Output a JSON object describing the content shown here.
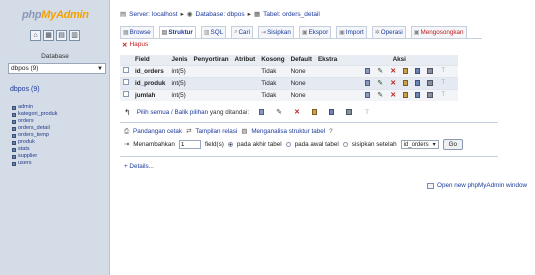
{
  "sidebar": {
    "logo_part1": "php",
    "logo_part2": "MyAdmin",
    "icons": [
      "home-icon",
      "sql-query-icon",
      "docs-icon",
      "help-icon"
    ],
    "icon_glyphs": [
      "⌂",
      "▦",
      "▤",
      "▥"
    ],
    "database_label": "Database",
    "database_selected": "dbpos (9)",
    "db_title": "dbpos (9)",
    "tables": [
      "admin",
      "kategori_produk",
      "orders",
      "orders_detail",
      "orders_temp",
      "produk",
      "stats",
      "supplier",
      "users"
    ]
  },
  "breadcrumb": {
    "server": "Server: localhost",
    "database": "Database: dbpos",
    "table": "Tabel: orders_detail"
  },
  "tabs": [
    {
      "label": "Browse",
      "active": false,
      "danger": false
    },
    {
      "label": "Struktur",
      "active": true,
      "danger": false
    },
    {
      "label": "SQL",
      "active": false,
      "danger": false
    },
    {
      "label": "Cari",
      "active": false,
      "danger": false
    },
    {
      "label": "Sisipkan",
      "active": false,
      "danger": false
    },
    {
      "label": "Ekspor",
      "active": false,
      "danger": false
    },
    {
      "label": "Import",
      "active": false,
      "danger": false
    },
    {
      "label": "Operasi",
      "active": false,
      "danger": false
    },
    {
      "label": "Mengosongkan",
      "active": false,
      "danger": true
    }
  ],
  "hapus_label": "Hapus",
  "structure_table": {
    "headers": [
      "Field",
      "Jenis",
      "Penyortiran",
      "Atribut",
      "Kosong",
      "Default",
      "Ekstra",
      "Aksi"
    ],
    "rows": [
      {
        "field": "id_orders",
        "jenis": "int(5)",
        "penyortiran": "",
        "atribut": "",
        "kosong": "Tidak",
        "default": "None",
        "ekstra": ""
      },
      {
        "field": "id_produk",
        "jenis": "int(5)",
        "penyortiran": "",
        "atribut": "",
        "kosong": "Tidak",
        "default": "None",
        "ekstra": ""
      },
      {
        "field": "jumlah",
        "jenis": "int(5)",
        "penyortiran": "",
        "atribut": "",
        "kosong": "Tidak",
        "default": "None",
        "ekstra": ""
      }
    ]
  },
  "check_all": {
    "select_all": "Pilih semua",
    "separator": "/",
    "deselect_all": "Balik pilihan",
    "with_selected": "yang ditandai:"
  },
  "links": {
    "print_view": "Pandangan cetak",
    "relation_view": "Tampilan relasi",
    "analyze": "Menganalisa struktur tabel"
  },
  "add_fields": {
    "label": "Menambahkan",
    "count": "1",
    "fields_text": "field(s)",
    "at_end": "pada akhir tabel",
    "at_start": "pada awal tabel",
    "after": "sisipkan setelah",
    "after_field": "id_orders",
    "go": "Go"
  },
  "details_link": "+ Details...",
  "new_window_link": "Open new phpMyAdmin window"
}
